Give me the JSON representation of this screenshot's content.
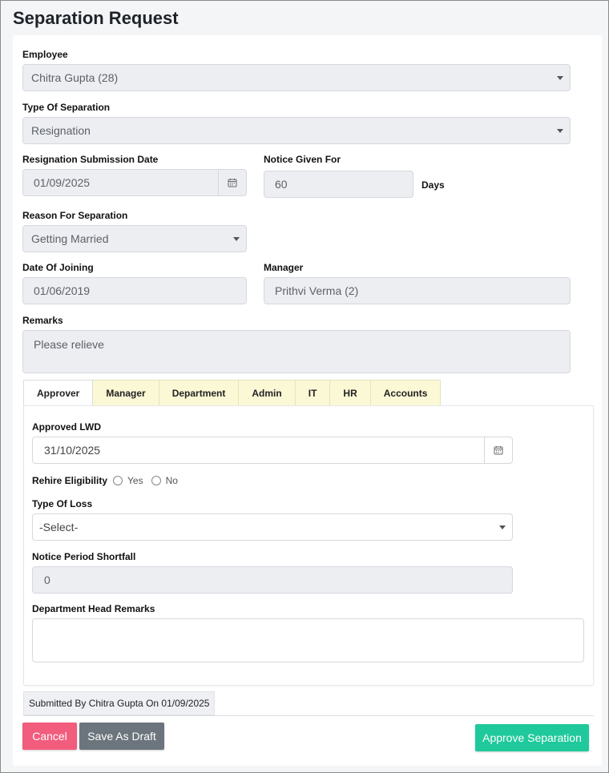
{
  "page": {
    "title": "Separation Request"
  },
  "employee": {
    "label": "Employee",
    "value": "Chitra Gupta (28)"
  },
  "separation_type": {
    "label": "Type Of Separation",
    "value": "Resignation"
  },
  "submission_date": {
    "label": "Resignation Submission Date",
    "value": "01/09/2025"
  },
  "notice": {
    "label": "Notice Given For",
    "value": "60",
    "unit": "Days"
  },
  "reason": {
    "label": "Reason For Separation",
    "value": "Getting Married"
  },
  "joining": {
    "label": "Date Of Joining",
    "value": "01/06/2019"
  },
  "manager": {
    "label": "Manager",
    "value": "Prithvi Verma (2)"
  },
  "remarks": {
    "label": "Remarks",
    "value": "Please relieve"
  },
  "tabs": [
    "Approver",
    "Manager",
    "Department",
    "Admin",
    "IT",
    "HR",
    "Accounts"
  ],
  "approver": {
    "lwd": {
      "label": "Approved LWD",
      "value": "31/10/2025"
    },
    "rehire": {
      "label": "Rehire Eligibility",
      "options": [
        "Yes",
        "No"
      ]
    },
    "loss_type": {
      "label": "Type Of Loss",
      "value": "-Select-"
    },
    "shortfall": {
      "label": "Notice Period Shortfall",
      "value": "0"
    },
    "dept_head_remarks": {
      "label": "Department Head Remarks",
      "value": ""
    }
  },
  "footer": {
    "submitted_text": "Submitted By Chitra Gupta On 01/09/2025",
    "cancel_label": "Cancel",
    "draft_label": "Save As Draft",
    "approve_label": "Approve Separation"
  },
  "colors": {
    "cancel": "#f25c7d",
    "draft": "#6c757d",
    "approve": "#1fc99b",
    "tab_inactive": "#fbf8d6"
  }
}
